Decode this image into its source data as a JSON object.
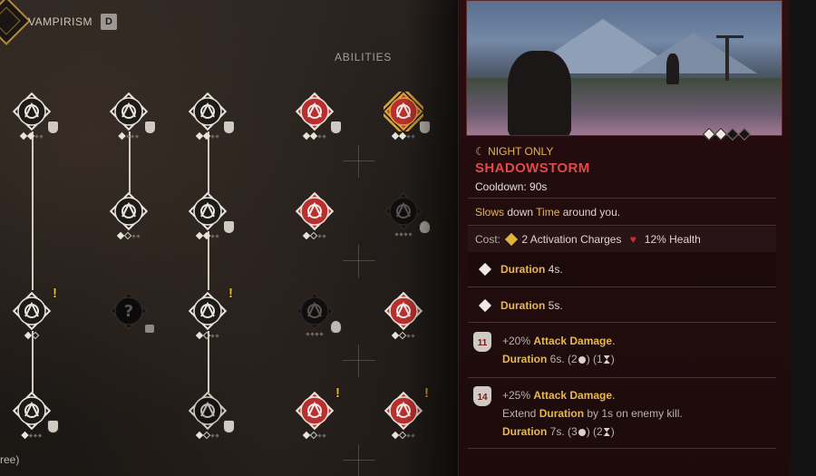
{
  "category": {
    "title": "VAMPIRISM",
    "hotkey": "D"
  },
  "tree": {
    "abilities_label": "ABILITIES",
    "footer_text": "ree)",
    "nodes": [
      {
        "id": "n1",
        "icon": "fangs-icon",
        "style": "white",
        "cost": "claw",
        "pips": [
          "full",
          "full",
          "small",
          "small"
        ]
      },
      {
        "id": "n2",
        "icon": "eye-icon",
        "style": "white",
        "cost": "claw",
        "pips": [
          "full",
          "small",
          "small",
          "small"
        ]
      },
      {
        "id": "n3",
        "icon": "blood-drops-icon",
        "style": "white",
        "cost": "claw",
        "pips": [
          "full",
          "full",
          "small",
          "small"
        ]
      },
      {
        "id": "n4",
        "icon": "howl-icon",
        "style": "red",
        "cost": "claw",
        "pips": [
          "full",
          "full",
          "small",
          "small"
        ]
      },
      {
        "id": "n5",
        "icon": "shadowstorm-icon",
        "style": "red-selected",
        "cost": "claw",
        "pips": [
          "full",
          "full",
          "small",
          "small"
        ]
      },
      {
        "id": "n6",
        "icon": "bat-swarm-icon",
        "style": "white",
        "cost": "none",
        "pips": [
          "full",
          "hollow",
          "small",
          "small"
        ]
      },
      {
        "id": "n7",
        "icon": "slash-icon",
        "style": "white",
        "cost": "claw",
        "pips": [
          "full",
          "full",
          "small",
          "small"
        ]
      },
      {
        "id": "n8",
        "icon": "wolf-head-icon",
        "style": "red",
        "cost": "none",
        "pips": [
          "full",
          "hollow",
          "small",
          "small"
        ]
      },
      {
        "id": "n9",
        "icon": "dark-burst-icon",
        "style": "dark",
        "cost": "skull",
        "pips": [
          "small",
          "small",
          "small",
          "small"
        ]
      },
      {
        "id": "n10",
        "icon": "claw-marks-icon",
        "style": "white",
        "warn": "!",
        "cost": "none",
        "pips": [
          "full",
          "hollow"
        ]
      },
      {
        "id": "n11",
        "icon": "unknown-icon",
        "style": "locked",
        "cost": "lock",
        "pips": []
      },
      {
        "id": "n12",
        "icon": "claw-strike-icon",
        "style": "white",
        "warn": "!",
        "cost": "none",
        "pips": [
          "full",
          "hollow",
          "small",
          "small"
        ]
      },
      {
        "id": "n13",
        "icon": "vortex-icon",
        "style": "dark",
        "cost": "skull",
        "pips": [
          "small",
          "small",
          "small",
          "small"
        ]
      },
      {
        "id": "n14",
        "icon": "roar-icon",
        "style": "red",
        "cost": "none",
        "pips": [
          "full",
          "hollow",
          "small",
          "small"
        ]
      },
      {
        "id": "n15",
        "icon": "blood-drop-icon",
        "style": "white",
        "cost": "claw",
        "pips": [
          "full",
          "small",
          "small",
          "small"
        ]
      },
      {
        "id": "n16",
        "icon": "beast-claw-icon",
        "style": "dark-outline",
        "cost": "claw",
        "pips": [
          "full",
          "hollow",
          "small",
          "small"
        ]
      },
      {
        "id": "n17",
        "icon": "demon-face-icon",
        "style": "red",
        "warn": "!",
        "cost": "none",
        "pips": [
          "full",
          "hollow",
          "small",
          "small"
        ]
      },
      {
        "id": "n18",
        "icon": "heart-icon",
        "style": "red",
        "warn": "!",
        "cost": "none",
        "pips": [
          "full",
          "hollow",
          "small",
          "small"
        ]
      }
    ]
  },
  "detail": {
    "rank_diamonds": [
      true,
      true,
      false,
      false
    ],
    "tag_icon": "crescent-moon-icon",
    "tag": "NIGHT ONLY",
    "name": "SHADOWSTORM",
    "cooldown": "Cooldown: 90s",
    "description": {
      "w1": "Slows",
      "t1": " down ",
      "w2": "Time",
      "t2": " around you."
    },
    "cost": {
      "label": "Cost:",
      "charges": "2 Activation Charges",
      "health": "12% Health"
    },
    "stats": [
      {
        "label": "Duration",
        "value": " 4s."
      },
      {
        "label": "Duration",
        "value": " 5s."
      }
    ],
    "tiers": [
      {
        "badge": "11",
        "line1_prefix": "+20% ",
        "line1_label": "Attack Damage",
        "line1_suffix": ".",
        "line2_label": "Duration",
        "line2_value": " 6s. ",
        "line2_extra1": "(2",
        "line2_extra2": ") (1",
        "line2_extra3": ")"
      },
      {
        "badge": "14",
        "line1_prefix": "+25% ",
        "line1_label": "Attack Damage",
        "line1_suffix": ".",
        "extend_prefix": "Extend ",
        "extend_label": "Duration",
        "extend_suffix": " by 1s on enemy kill.",
        "line3_label": "Duration",
        "line3_value": " 7s. ",
        "line3_extra1": "(3",
        "line3_extra2": ") (2",
        "line3_extra3": ")"
      }
    ]
  },
  "colors": {
    "accent_red": "#e04a48",
    "gold": "#e8b84e",
    "panel_bg": "#220c0e"
  }
}
